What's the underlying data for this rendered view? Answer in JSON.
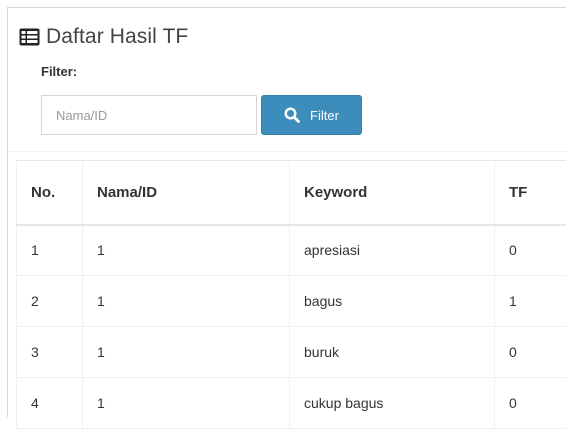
{
  "panel": {
    "title": "Daftar Hasil TF",
    "title_icon": "list-table-icon"
  },
  "filter": {
    "label": "Filter:",
    "input_placeholder": "Nama/ID",
    "input_value": "",
    "button_label": "Filter",
    "button_icon": "search-icon",
    "button_color": "#3c8dbc"
  },
  "table": {
    "headers": [
      "No.",
      "Nama/ID",
      "Keyword",
      "TF"
    ],
    "rows": [
      [
        "1",
        "1",
        "apresiasi",
        "0"
      ],
      [
        "2",
        "1",
        "bagus",
        "1"
      ],
      [
        "3",
        "1",
        "buruk",
        "0"
      ],
      [
        "4",
        "1",
        "cukup bagus",
        "0"
      ]
    ]
  }
}
